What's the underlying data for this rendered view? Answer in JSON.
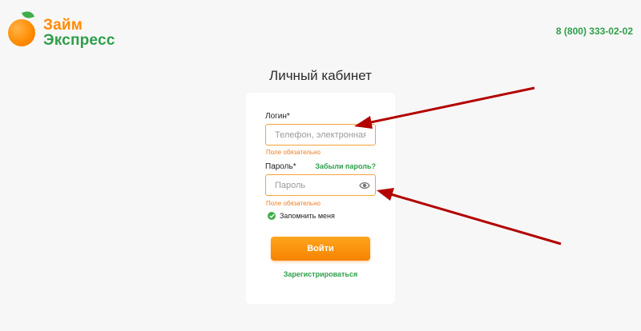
{
  "brand": {
    "line1": "Займ",
    "line2": "Экспресс"
  },
  "header": {
    "phone": "8 (800) 333-02-02"
  },
  "page": {
    "title": "Личный кабинет"
  },
  "form": {
    "login_label": "Логин*",
    "login_placeholder": "Телефон, электронная почта",
    "login_error": "Поле обязательно",
    "password_label": "Пароль*",
    "forgot_link": "Забыли пароль?",
    "password_placeholder": "Пароль",
    "password_error": "Поле обязательно",
    "remember_label": "Запомнить меня",
    "submit_label": "Войти",
    "register_link": "Зарегистрироваться"
  },
  "colors": {
    "accent_orange": "#ff8a00",
    "brand_green": "#2e9f4a",
    "error": "#f07c1f",
    "arrow": "#b30000"
  }
}
